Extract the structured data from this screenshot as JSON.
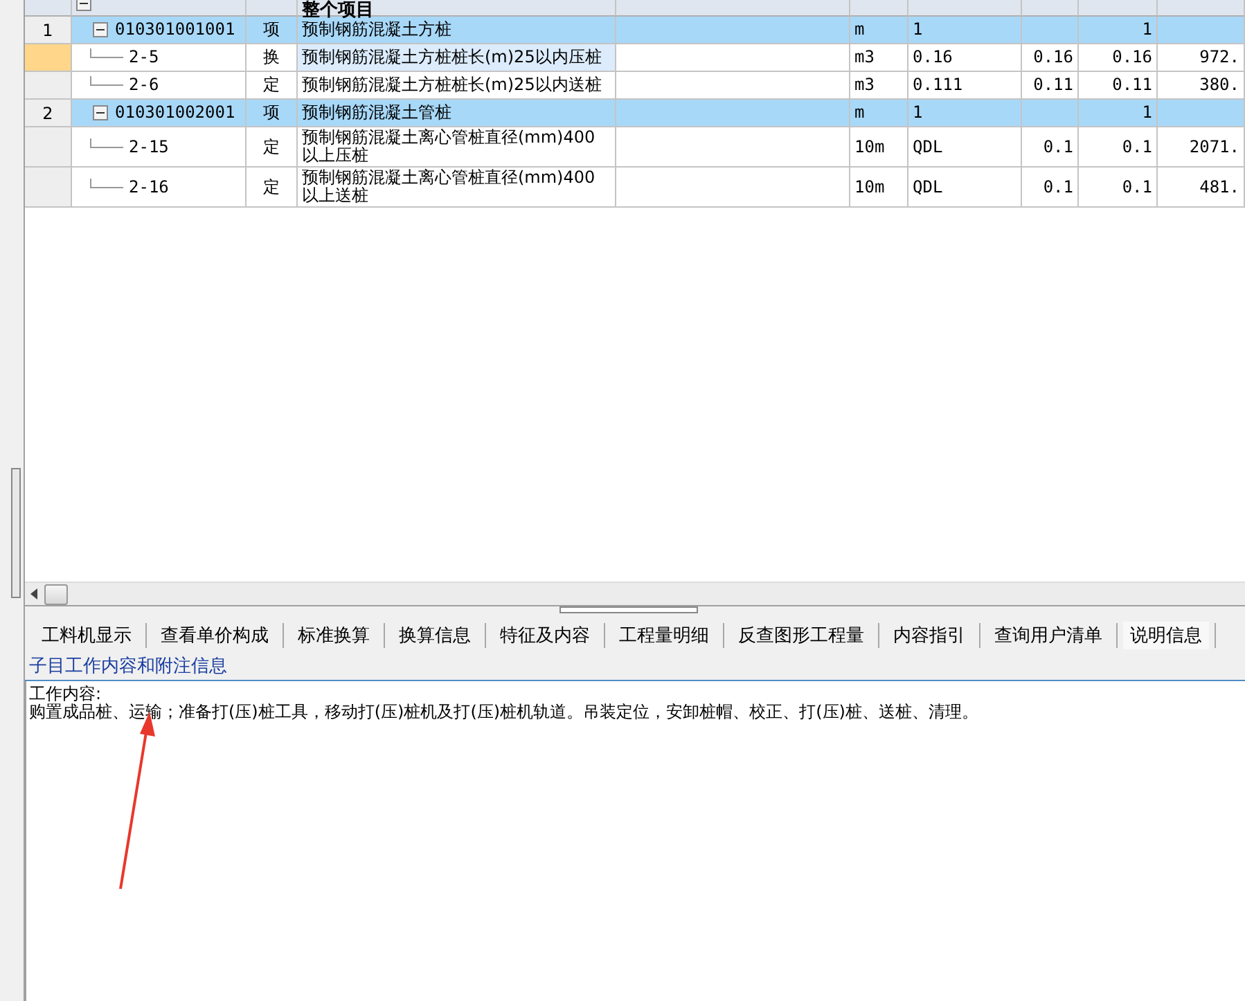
{
  "table": {
    "header": {
      "title": "整个项目",
      "expanded": true
    },
    "rows": [
      {
        "kind": "item",
        "number": "1",
        "code": "010301001001",
        "type": "项",
        "name": "预制钢筋混凝土方桩",
        "column_5": "",
        "unit": "m",
        "quantity_expression": "1",
        "column_8": "",
        "column_9": "1",
        "column_10": "",
        "expanded": true,
        "selected": false
      },
      {
        "kind": "sub",
        "number": "",
        "code": "2-5",
        "type": "换",
        "name": "预制钢筋混凝土方桩桩长(m)25以内压桩",
        "column_5": "",
        "unit": "m3",
        "quantity_expression": "0.16",
        "column_8": "0.16",
        "column_9": "0.16",
        "column_10": "972.",
        "selected": true
      },
      {
        "kind": "sub",
        "number": "",
        "code": "2-6",
        "type": "定",
        "name": "预制钢筋混凝土方桩桩长(m)25以内送桩",
        "column_5": "",
        "unit": "m3",
        "quantity_expression": "0.111",
        "column_8": "0.11",
        "column_9": "0.11",
        "column_10": "380.",
        "selected": false
      },
      {
        "kind": "item",
        "number": "2",
        "code": "010301002001",
        "type": "项",
        "name": "预制钢筋混凝土管桩",
        "column_5": "",
        "unit": "m",
        "quantity_expression": "1",
        "column_8": "",
        "column_9": "1",
        "column_10": "",
        "expanded": true,
        "selected": false
      },
      {
        "kind": "sub",
        "number": "",
        "code": "2-15",
        "type": "定",
        "name": "预制钢筋混凝土离心管桩直径(mm)400以上压桩",
        "column_5": "",
        "unit": "10m",
        "quantity_expression": "QDL",
        "column_8": "0.1",
        "column_9": "0.1",
        "column_10": "2071.",
        "selected": false
      },
      {
        "kind": "sub",
        "number": "",
        "code": "2-16",
        "type": "定",
        "name": "预制钢筋混凝土离心管桩直径(mm)400以上送桩",
        "column_5": "",
        "unit": "10m",
        "quantity_expression": "QDL",
        "column_8": "0.1",
        "column_9": "0.1",
        "column_10": "481.",
        "selected": false
      }
    ]
  },
  "tabs": [
    {
      "label": "工料机显示",
      "selected": false
    },
    {
      "label": "查看单价构成",
      "selected": false
    },
    {
      "label": "标准换算",
      "selected": false
    },
    {
      "label": "换算信息",
      "selected": false
    },
    {
      "label": "特征及内容",
      "selected": false
    },
    {
      "label": "工程量明细",
      "selected": false
    },
    {
      "label": "反查图形工程量",
      "selected": false
    },
    {
      "label": "内容指引",
      "selected": false
    },
    {
      "label": "查询用户清单",
      "selected": false
    },
    {
      "label": "说明信息",
      "selected": true
    }
  ],
  "info_panel": {
    "title": "子目工作内容和附注信息",
    "heading": "工作内容:",
    "text": "购置成品桩、运输；准备打(压)桩工具，移动打(压)桩机及打(压)桩机轨道。吊装定位，安卸桩帽、校正、打(压)桩、送桩、清理。"
  }
}
